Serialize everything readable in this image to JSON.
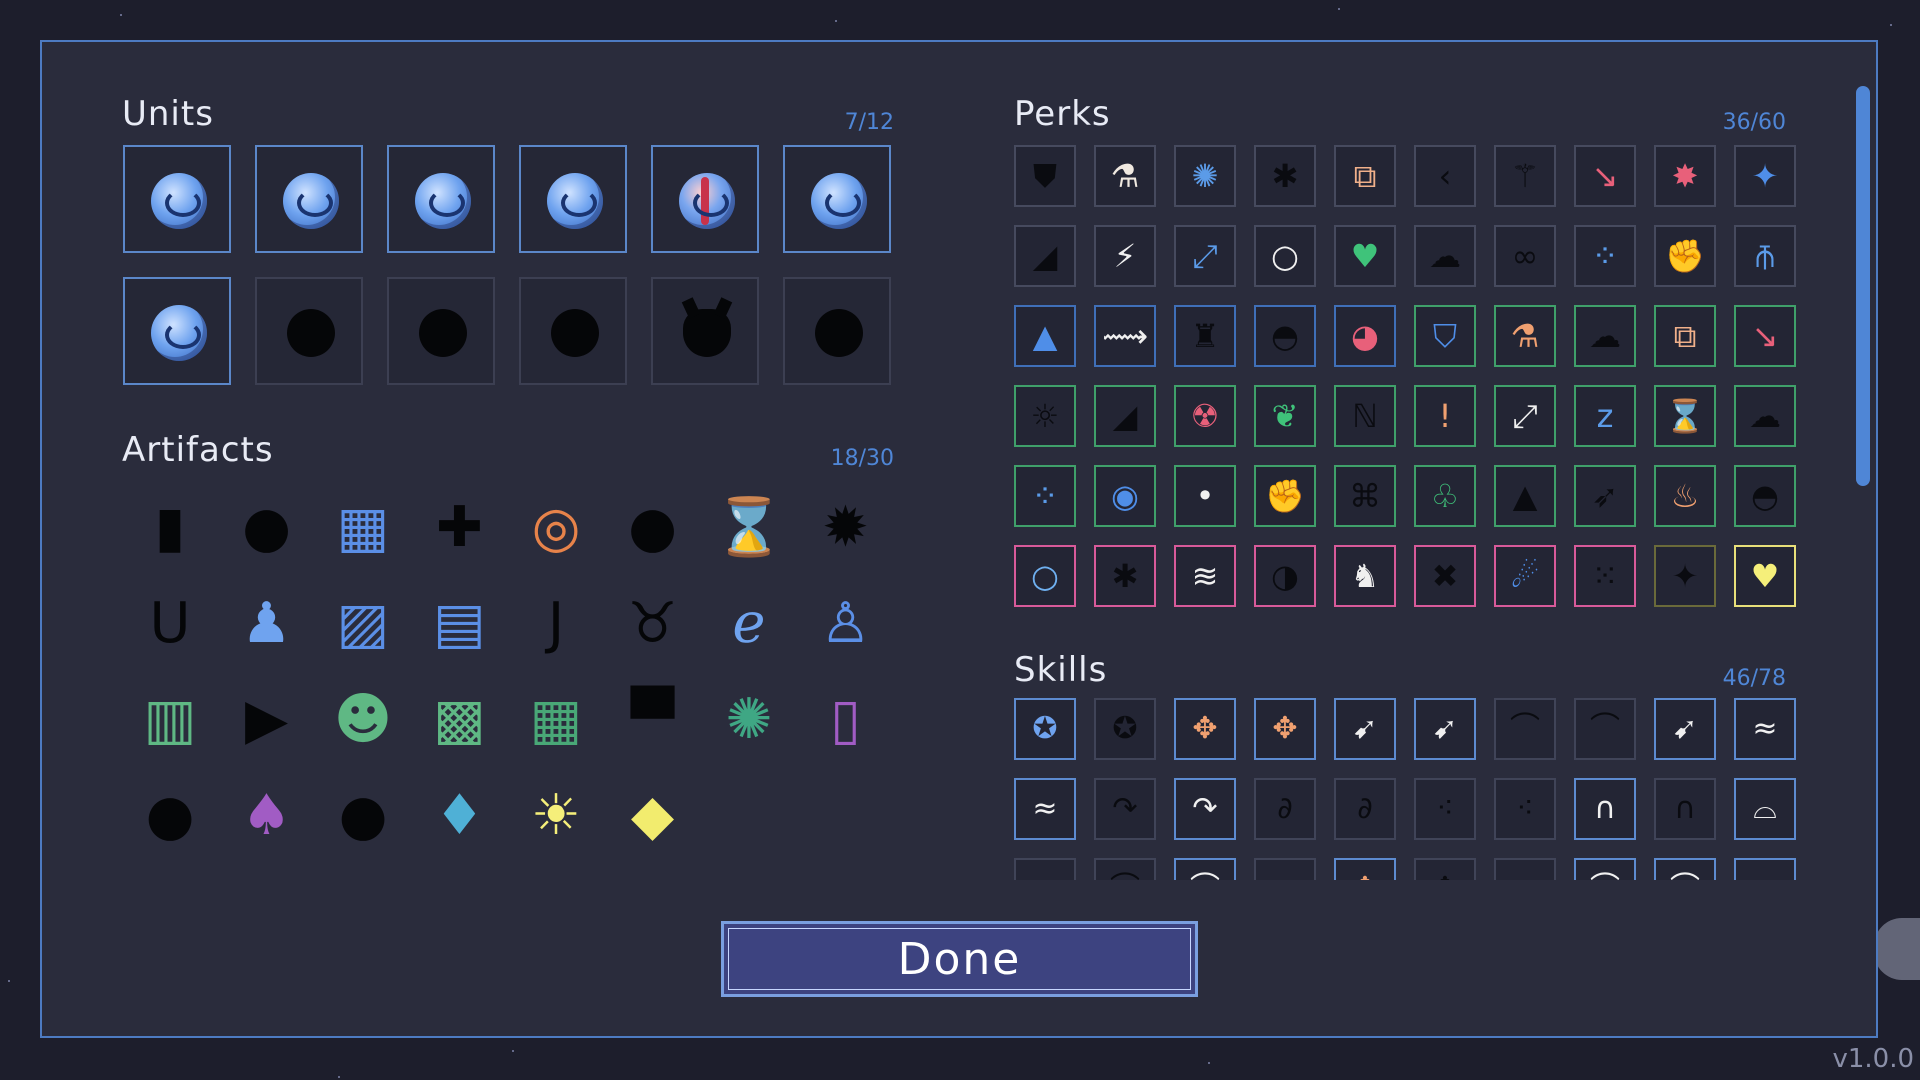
{
  "units": {
    "title": "Units",
    "count": "7/12",
    "items": [
      {
        "icon": "blue-orb-unit",
        "state": "unlocked"
      },
      {
        "icon": "blue-orb-unit",
        "state": "unlocked"
      },
      {
        "icon": "blue-orb-unit",
        "state": "unlocked"
      },
      {
        "icon": "blue-orb-unit",
        "state": "unlocked"
      },
      {
        "icon": "red-striped-orb-unit",
        "state": "unlocked"
      },
      {
        "icon": "blue-orb-unit",
        "state": "unlocked"
      },
      {
        "icon": "crystal-orb-unit",
        "state": "unlocked"
      },
      {
        "icon": "locked-silhouette",
        "state": "locked"
      },
      {
        "icon": "locked-silhouette",
        "state": "locked"
      },
      {
        "icon": "locked-silhouette",
        "state": "locked"
      },
      {
        "icon": "locked-horned-silhouette",
        "state": "locked"
      },
      {
        "icon": "locked-silhouette",
        "state": "locked"
      }
    ]
  },
  "artifacts": {
    "title": "Artifacts",
    "count": "18/30",
    "items": [
      {
        "icon": "locked-artifact",
        "glyph": "▮",
        "color": "#050608"
      },
      {
        "icon": "locked-artifact",
        "glyph": "●",
        "color": "#050608"
      },
      {
        "icon": "calendar-icon",
        "glyph": "▦",
        "color": "#5b8fe6"
      },
      {
        "icon": "locked-artifact",
        "glyph": "✚",
        "color": "#050608"
      },
      {
        "icon": "donut-icon",
        "glyph": "◎",
        "color": "#e7834a"
      },
      {
        "icon": "locked-artifact",
        "glyph": "●",
        "color": "#050608"
      },
      {
        "icon": "hourglass-icon",
        "glyph": "⌛",
        "color": "#6fa3ef"
      },
      {
        "icon": "locked-artifact",
        "glyph": "✹",
        "color": "#050608"
      },
      {
        "icon": "locked-artifact",
        "glyph": "U",
        "color": "#050608"
      },
      {
        "icon": "flask-icon",
        "glyph": "♟",
        "color": "#6fa3ef"
      },
      {
        "icon": "picture-icon",
        "glyph": "▨",
        "color": "#5b8fe6"
      },
      {
        "icon": "printer-icon",
        "glyph": "▤",
        "color": "#5b8fe6"
      },
      {
        "icon": "locked-artifact",
        "glyph": "J",
        "color": "#050608"
      },
      {
        "icon": "locked-artifact",
        "glyph": "♉",
        "color": "#050608"
      },
      {
        "icon": "spring-icon",
        "glyph": "ℯ",
        "color": "#6fa3ef"
      },
      {
        "icon": "robot-figure-icon",
        "glyph": "♙",
        "color": "#5b8fe6"
      },
      {
        "icon": "stacked-cans-icon",
        "glyph": "▥",
        "color": "#5fb884"
      },
      {
        "icon": "locked-artifact",
        "glyph": "▶",
        "color": "#050608"
      },
      {
        "icon": "alien-head-icon",
        "glyph": "☻",
        "color": "#5fb884"
      },
      {
        "icon": "green-map-icon",
        "glyph": "▩",
        "color": "#5fb884"
      },
      {
        "icon": "green-board-icon",
        "glyph": "▦",
        "color": "#49a877"
      },
      {
        "icon": "locked-artifact",
        "glyph": "▀",
        "color": "#050608"
      },
      {
        "icon": "spider-orb-icon",
        "glyph": "✺",
        "color": "#3fa784"
      },
      {
        "icon": "purple-jar-icon",
        "glyph": "▯",
        "color": "#a15cc4"
      },
      {
        "icon": "locked-artifact",
        "glyph": "●",
        "color": "#050608"
      },
      {
        "icon": "purple-vase-icon",
        "glyph": "♠",
        "color": "#a15cc4"
      },
      {
        "icon": "locked-artifact",
        "glyph": "●",
        "color": "#050608"
      },
      {
        "icon": "crystal-icon",
        "glyph": "♦",
        "color": "#4fb0d6"
      },
      {
        "icon": "sun-icon",
        "glyph": "☀",
        "color": "#f5ef7a"
      },
      {
        "icon": "diamond-icon",
        "glyph": "◆",
        "color": "#f2ec6e"
      }
    ]
  },
  "perks": {
    "title": "Perks",
    "count": "36/60",
    "items": [
      {
        "icon": "shield-icon",
        "glyph": "⛊",
        "color": "#0a0b10",
        "border": "#464a5e"
      },
      {
        "icon": "flask-icon",
        "glyph": "⚗",
        "color": "#f0e9e0",
        "border": "#464a5e"
      },
      {
        "icon": "comet-icon",
        "glyph": "✺",
        "color": "#5b9be8",
        "border": "#464a5e"
      },
      {
        "icon": "spider-icon",
        "glyph": "✱",
        "color": "#0a0b10",
        "border": "#464a5e"
      },
      {
        "icon": "box-orb-icon",
        "glyph": "⧉",
        "color": "#f0b08a",
        "border": "#464a5e"
      },
      {
        "icon": "arrow-left-icon",
        "glyph": "‹",
        "color": "#0a0b10",
        "border": "#464a5e"
      },
      {
        "icon": "sling-icon",
        "glyph": "⚚",
        "color": "#0a0b10",
        "border": "#464a5e"
      },
      {
        "icon": "bounce-icon",
        "glyph": "↘",
        "color": "#e8607a",
        "border": "#464a5e"
      },
      {
        "icon": "burst-icon",
        "glyph": "✸",
        "color": "#e8607a",
        "border": "#464a5e"
      },
      {
        "icon": "sparkle-icon",
        "glyph": "✦",
        "color": "#4f8ee8",
        "border": "#464a5e"
      },
      {
        "icon": "ramp-icon",
        "glyph": "◢",
        "color": "#0a0b10",
        "border": "#464a5e"
      },
      {
        "icon": "zigzag-icon",
        "glyph": "⚡",
        "color": "#f0f0f0",
        "border": "#464a5e"
      },
      {
        "icon": "expand-icon",
        "glyph": "⤢",
        "color": "#5b9be8",
        "border": "#464a5e"
      },
      {
        "icon": "ring-icon",
        "glyph": "○",
        "color": "#f0f0f0",
        "border": "#464a5e"
      },
      {
        "icon": "heart-icon",
        "glyph": "♥",
        "color": "#3fc37a",
        "border": "#464a5e"
      },
      {
        "icon": "cloud-icon",
        "glyph": "☁",
        "color": "#0a0b10",
        "border": "#464a5e"
      },
      {
        "icon": "double-orb-icon",
        "glyph": "∞",
        "color": "#0a0b10",
        "border": "#464a5e"
      },
      {
        "icon": "cluster-icon",
        "glyph": "⁘",
        "color": "#5b9be8",
        "border": "#464a5e"
      },
      {
        "icon": "fist-icon",
        "glyph": "✊",
        "color": "#f0a070",
        "border": "#464a5e"
      },
      {
        "icon": "split-icon",
        "glyph": "⫚",
        "color": "#5b9be8",
        "border": "#464a5e"
      },
      {
        "icon": "triangle-icon",
        "glyph": "▲",
        "color": "#4f8ee8",
        "border": "#3f6fb8"
      },
      {
        "icon": "trajectory-icon",
        "glyph": "⟿",
        "color": "#f0f0f0",
        "border": "#3f6fb8"
      },
      {
        "icon": "bag-icon",
        "glyph": "♜",
        "color": "#0a0b10",
        "border": "#3f6fb8"
      },
      {
        "icon": "helmet-icon",
        "glyph": "◓",
        "color": "#0a0b10",
        "border": "#3f6fb8"
      },
      {
        "icon": "planet-icon",
        "glyph": "◕",
        "color": "#e8607a",
        "border": "#3f6fb8"
      },
      {
        "icon": "shield-sword-icon",
        "glyph": "⛉",
        "color": "#4f8ee8",
        "border": "#3fa06a"
      },
      {
        "icon": "flask-icon",
        "glyph": "⚗",
        "color": "#f0a070",
        "border": "#3fa06a"
      },
      {
        "icon": "smoke-icon",
        "glyph": "☁",
        "color": "#0a0b10",
        "border": "#3fa06a"
      },
      {
        "icon": "box-orb-icon",
        "glyph": "⧉",
        "color": "#f0b08a",
        "border": "#3fa06a"
      },
      {
        "icon": "bounce-icon",
        "glyph": "↘",
        "color": "#e8607a",
        "border": "#3fa06a"
      },
      {
        "icon": "rays-icon",
        "glyph": "☼",
        "color": "#0a0b10",
        "border": "#3fa06a"
      },
      {
        "icon": "ramp-icon",
        "glyph": "◢",
        "color": "#0a0b10",
        "border": "#3fa06a"
      },
      {
        "icon": "radiation-icon",
        "glyph": "☢",
        "color": "#e8607a",
        "border": "#3fa06a"
      },
      {
        "icon": "hearts-icon",
        "glyph": "❦",
        "color": "#3fc37a",
        "border": "#3fa06a"
      },
      {
        "icon": "zigzag-icon",
        "glyph": "ℕ",
        "color": "#0a0b10",
        "border": "#3fa06a"
      },
      {
        "icon": "exclamation-icon",
        "glyph": "!",
        "color": "#f0a070",
        "border": "#3fa06a"
      },
      {
        "icon": "expand-icon",
        "glyph": "⤢",
        "color": "#f0f0f0",
        "border": "#3fa06a"
      },
      {
        "icon": "sleep-icon",
        "glyph": "z",
        "color": "#5b9be8",
        "border": "#3fa06a"
      },
      {
        "icon": "hourglass-icon",
        "glyph": "⌛",
        "color": "#0a0b10",
        "border": "#3fa06a"
      },
      {
        "icon": "cloud-icon",
        "glyph": "☁",
        "color": "#0a0b10",
        "border": "#3fa06a"
      },
      {
        "icon": "cluster-icon",
        "glyph": "⁘",
        "color": "#5b9be8",
        "border": "#3fa06a"
      },
      {
        "icon": "orbit-icon",
        "glyph": "◉",
        "color": "#4f8ee8",
        "border": "#3fa06a"
      },
      {
        "icon": "dot-icon",
        "glyph": "•",
        "color": "#f0f0f0",
        "border": "#3fa06a"
      },
      {
        "icon": "fist-icon",
        "glyph": "✊",
        "color": "#f0a070",
        "border": "#3fa06a"
      },
      {
        "icon": "network-icon",
        "glyph": "⌘",
        "color": "#0a0b10",
        "border": "#3fa06a"
      },
      {
        "icon": "lungs-icon",
        "glyph": "♧",
        "color": "#3fc37a",
        "border": "#3fa06a"
      },
      {
        "icon": "triangle-icon",
        "glyph": "▲",
        "color": "#0a0b10",
        "border": "#3fa06a"
      },
      {
        "icon": "bow-icon",
        "glyph": "➶",
        "color": "#0a0b10",
        "border": "#3fa06a"
      },
      {
        "icon": "money-bag-icon",
        "glyph": "♨",
        "color": "#f0a070",
        "border": "#3fa06a"
      },
      {
        "icon": "helmet-icon",
        "glyph": "◓",
        "color": "#0a0b10",
        "border": "#3fa06a"
      },
      {
        "icon": "ring-orb-icon",
        "glyph": "○",
        "color": "#6fb0f0",
        "border": "#d85a9a"
      },
      {
        "icon": "beetle-icon",
        "glyph": "✱",
        "color": "#0a0b10",
        "border": "#d85a9a"
      },
      {
        "icon": "chevrons-icon",
        "glyph": "≋",
        "color": "#f0f0f0",
        "border": "#d85a9a"
      },
      {
        "icon": "brain-icon",
        "glyph": "◑",
        "color": "#0a0b10",
        "border": "#d85a9a"
      },
      {
        "icon": "wolf-icon",
        "glyph": "♞",
        "color": "#f0f0f0",
        "border": "#d85a9a"
      },
      {
        "icon": "bones-icon",
        "glyph": "✖",
        "color": "#0a0b10",
        "border": "#d85a9a"
      },
      {
        "icon": "comet-icon",
        "glyph": "☄",
        "color": "#4f8ee8",
        "border": "#d85a9a"
      },
      {
        "icon": "cluster-icon",
        "glyph": "⁙",
        "color": "#0a0b10",
        "border": "#d85a9a"
      },
      {
        "icon": "star-icon",
        "glyph": "✦",
        "color": "#0a0b10",
        "border": "#6a6a3a"
      },
      {
        "icon": "heart-icon",
        "glyph": "♥",
        "color": "#f5ef7a",
        "border": "#e8e07a"
      }
    ]
  },
  "skills": {
    "title": "Skills",
    "count": "46/78",
    "items": [
      {
        "icon": "orbit-skill-icon",
        "glyph": "✪",
        "color": "#6fa3ef",
        "state": "unlocked"
      },
      {
        "icon": "swirl-skill-icon",
        "glyph": "✪",
        "color": "#0a0b10",
        "state": "locked"
      },
      {
        "icon": "split-orbs-skill-icon",
        "glyph": "✥",
        "color": "#f0a070",
        "state": "unlocked"
      },
      {
        "icon": "split-orbs-skill-icon",
        "glyph": "✥",
        "color": "#f0a070",
        "state": "unlocked"
      },
      {
        "icon": "shot-skill-icon",
        "glyph": "➹",
        "color": "#f0f0f0",
        "state": "unlocked"
      },
      {
        "icon": "shot-skill-icon",
        "glyph": "➹",
        "color": "#f0f0f0",
        "state": "unlocked"
      },
      {
        "icon": "arc-skill-icon",
        "glyph": "⌒",
        "color": "#0a0b10",
        "state": "locked"
      },
      {
        "icon": "arc-skill-icon",
        "glyph": "⌒",
        "color": "#0a0b10",
        "state": "locked"
      },
      {
        "icon": "shot-skill-icon",
        "glyph": "➹",
        "color": "#f0f0f0",
        "state": "unlocked"
      },
      {
        "icon": "wave-skill-icon",
        "glyph": "≈",
        "color": "#f0f0f0",
        "state": "unlocked"
      },
      {
        "icon": "wave-skill-icon",
        "glyph": "≈",
        "color": "#f0f0f0",
        "state": "unlocked"
      },
      {
        "icon": "bounce-skill-icon",
        "glyph": "↷",
        "color": "#0a0b10",
        "state": "locked"
      },
      {
        "icon": "bounce-skill-icon",
        "glyph": "↷",
        "color": "#f0f0f0",
        "state": "unlocked"
      },
      {
        "icon": "chain-skill-icon",
        "glyph": "∂",
        "color": "#0a0b10",
        "state": "locked"
      },
      {
        "icon": "chain-skill-icon",
        "glyph": "∂",
        "color": "#0a0b10",
        "state": "locked"
      },
      {
        "icon": "scatter-skill-icon",
        "glyph": "⁖",
        "color": "#0a0b10",
        "state": "locked"
      },
      {
        "icon": "scatter-skill-icon",
        "glyph": "⁖",
        "color": "#0a0b10",
        "state": "locked"
      },
      {
        "icon": "arch-skill-icon",
        "glyph": "∩",
        "color": "#f0f0f0",
        "state": "unlocked"
      },
      {
        "icon": "arch-skill-icon",
        "glyph": "∩",
        "color": "#0a0b10",
        "state": "locked"
      },
      {
        "icon": "arch-skill-icon",
        "glyph": "⌓",
        "color": "#f0f0f0",
        "state": "unlocked"
      },
      {
        "icon": "skill-icon",
        "glyph": "",
        "color": "#0a0b10",
        "state": "locked"
      },
      {
        "icon": "skill-icon",
        "glyph": "⌒",
        "color": "#0a0b10",
        "state": "locked"
      },
      {
        "icon": "skill-icon",
        "glyph": "⌒",
        "color": "#f0f0f0",
        "state": "unlocked"
      },
      {
        "icon": "skill-icon",
        "glyph": "",
        "color": "#0a0b10",
        "state": "locked"
      },
      {
        "icon": "skill-icon",
        "glyph": "✥",
        "color": "#f0a070",
        "state": "unlocked"
      },
      {
        "icon": "skill-icon",
        "glyph": "✥",
        "color": "#0a0b10",
        "state": "locked"
      },
      {
        "icon": "skill-icon",
        "glyph": "",
        "color": "#0a0b10",
        "state": "locked"
      },
      {
        "icon": "skill-icon",
        "glyph": "⌒",
        "color": "#f0f0f0",
        "state": "unlocked"
      },
      {
        "icon": "skill-icon",
        "glyph": "⌒",
        "color": "#f0f0f0",
        "state": "unlocked"
      },
      {
        "icon": "skill-icon",
        "glyph": "›",
        "color": "#f0f0f0",
        "state": "unlocked"
      }
    ]
  },
  "done_label": "Done",
  "version": "v1.0.0"
}
